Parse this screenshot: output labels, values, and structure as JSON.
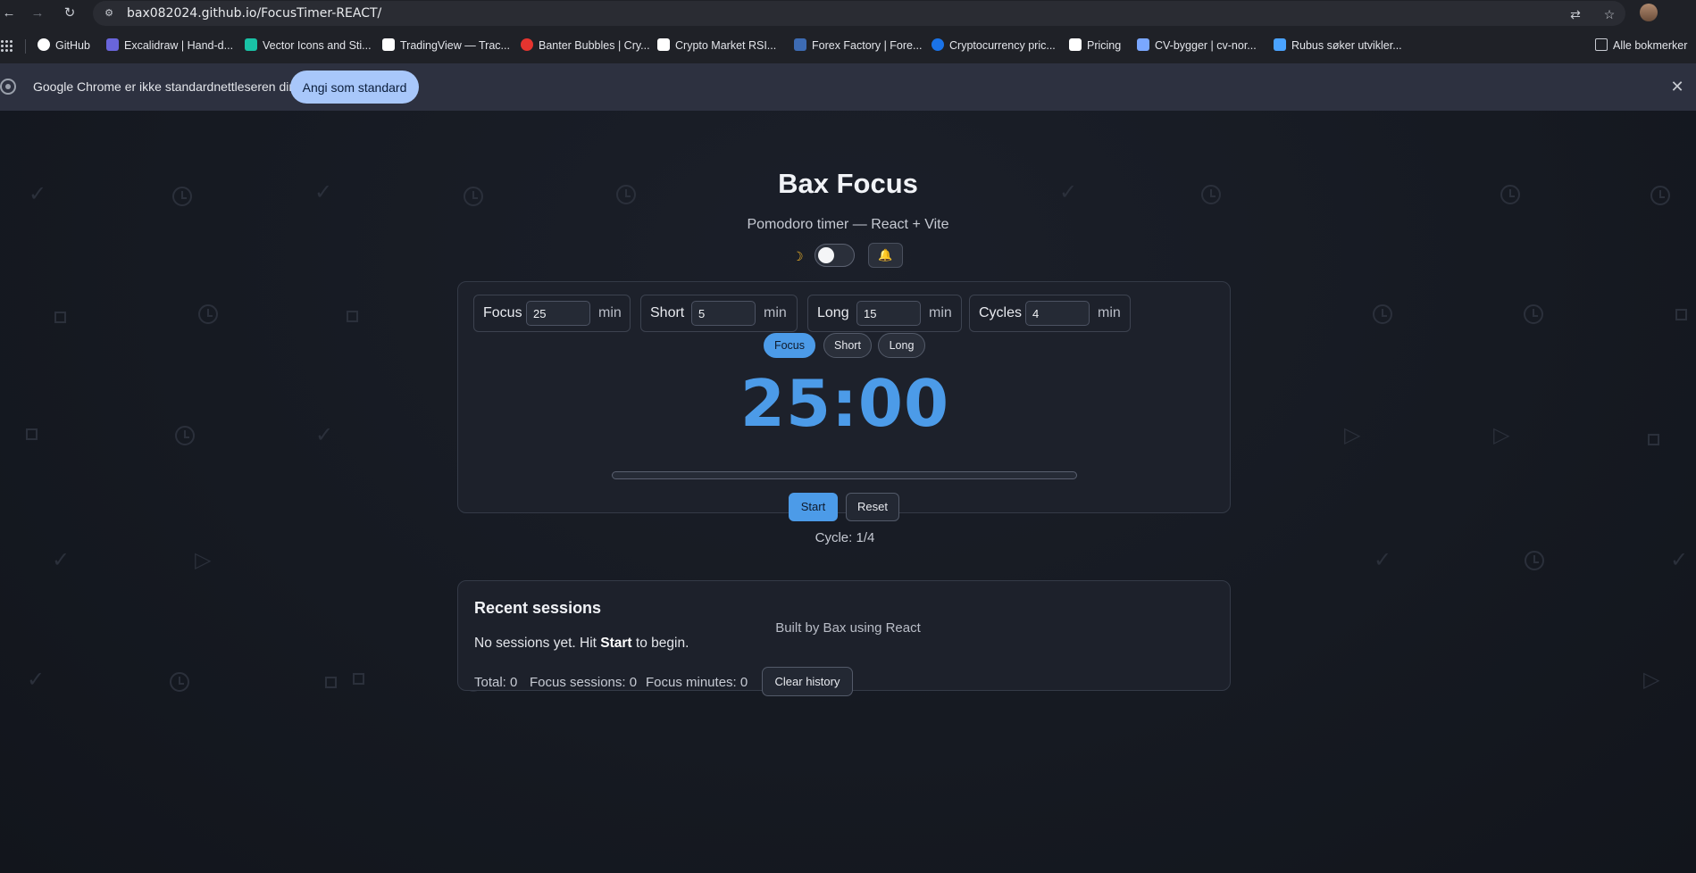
{
  "browser": {
    "url": "bax082024.github.io/FocusTimer-REACT/",
    "bookmarks": [
      {
        "label": "GitHub",
        "color": "#ffffff"
      },
      {
        "label": "Excalidraw | Hand-d...",
        "color": "#6965db"
      },
      {
        "label": "Vector Icons and Sti...",
        "color": "#19c2a6"
      },
      {
        "label": "TradingView — Trac...",
        "color": "#ffffff"
      },
      {
        "label": "Banter Bubbles | Cry...",
        "color": "#e5342f"
      },
      {
        "label": "Crypto Market RSI...",
        "color": "#ffffff"
      },
      {
        "label": "Forex Factory | Fore...",
        "color": "#3d6bb3"
      },
      {
        "label": "Cryptocurrency pric...",
        "color": "#1a73e8"
      },
      {
        "label": "Pricing",
        "color": "#ffffff"
      },
      {
        "label": "CV-bygger | cv-nor...",
        "color": "#7aa7ff"
      },
      {
        "label": "Rubus søker utvikler...",
        "color": "#4aa3ff"
      }
    ],
    "all_bookmarks": "Alle bokmerker",
    "infobar": {
      "text": "Google Chrome er ikke standardnettleseren din",
      "button": "Angi som standard"
    }
  },
  "app": {
    "title": "Bax Focus",
    "subtitle": "Pomodoro timer — React + Vite",
    "theme_icon": "moon-icon",
    "sound_icon": "bell-icon",
    "fields": [
      {
        "label": "Focus",
        "value": "25",
        "unit": "min"
      },
      {
        "label": "Short",
        "value": "5",
        "unit": "min"
      },
      {
        "label": "Long",
        "value": "15",
        "unit": "min"
      },
      {
        "label": "Cycles",
        "value": "4",
        "unit": "min"
      }
    ],
    "modes": [
      "Focus",
      "Short",
      "Long"
    ],
    "active_mode": "Focus",
    "time": "25:00",
    "progress": 0,
    "start": "Start",
    "reset": "Reset",
    "cycle": "Cycle: 1/4",
    "accent": "#4c9be8"
  },
  "recent": {
    "title": "Recent sessions",
    "empty_prefix": "No sessions yet. Hit ",
    "empty_bold": "Start",
    "empty_suffix": " to begin.",
    "total": "Total: 0",
    "focus_sessions": "Focus sessions: 0",
    "focus_minutes": "Focus minutes: 0",
    "clear": "Clear history"
  },
  "footer": "Built by Bax using React"
}
